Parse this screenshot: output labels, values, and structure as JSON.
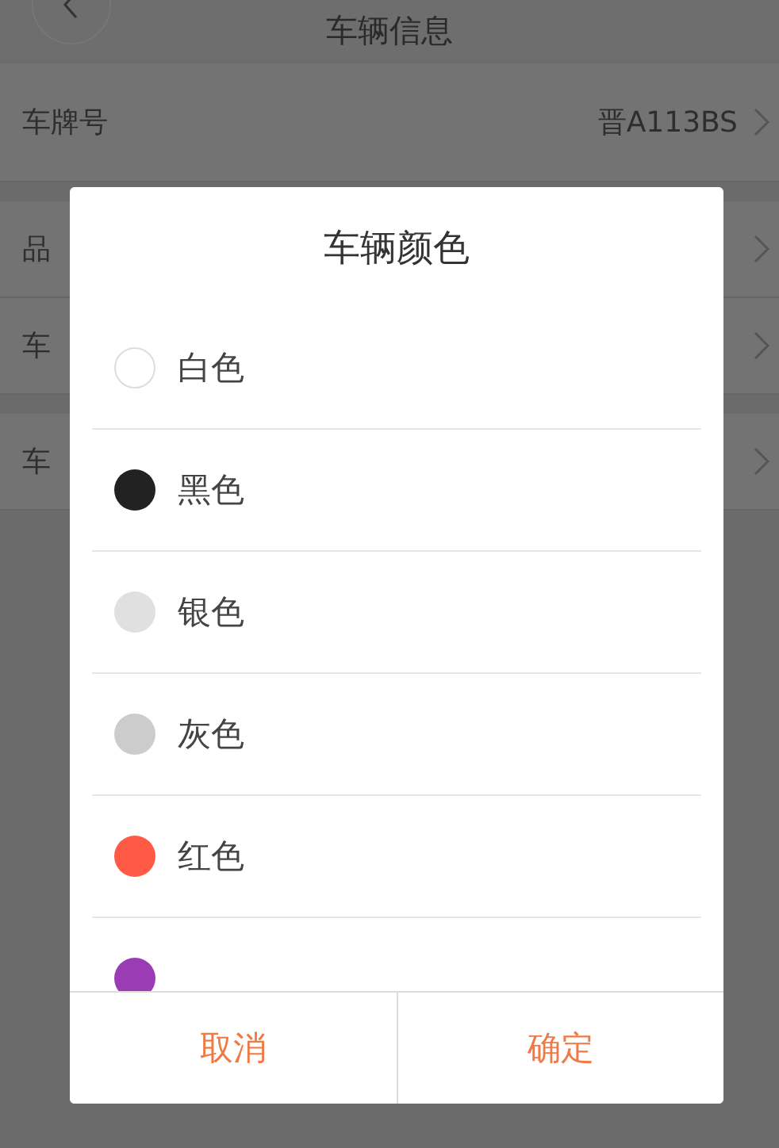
{
  "header": {
    "title": "车辆信息"
  },
  "rows": [
    {
      "label": "车牌号",
      "value": "晋A113BS"
    },
    {
      "label": "品"
    },
    {
      "label": "车"
    },
    {
      "label": "车"
    }
  ],
  "dialog": {
    "title": "车辆颜色",
    "options": [
      {
        "label": "白色",
        "color": "#ffffff"
      },
      {
        "label": "黑色",
        "color": "#222222"
      },
      {
        "label": "银色",
        "color": "#e0e0e0"
      },
      {
        "label": "灰色",
        "color": "#cccccc"
      },
      {
        "label": "红色",
        "color": "#ff5a45"
      },
      {
        "color": "#9c3cb5"
      }
    ],
    "buttons": [
      "取消",
      "确定"
    ]
  }
}
